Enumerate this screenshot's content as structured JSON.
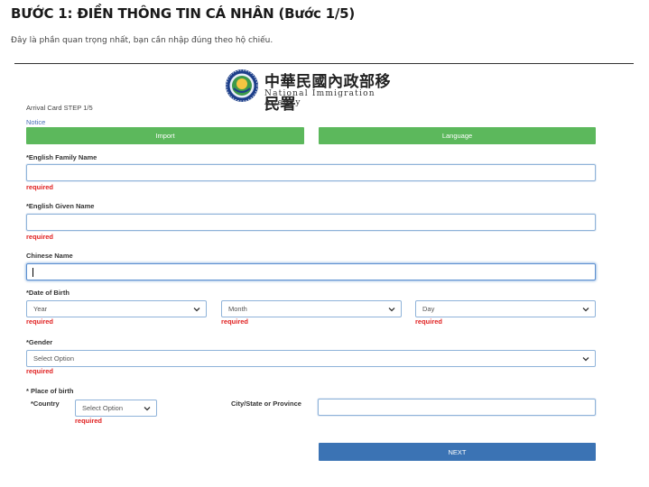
{
  "header": {
    "title": "BƯỚC 1: ĐIỀN THÔNG TIN CÁ NHÂN (Bước 1/5)",
    "subtitle": "Đây là phần quan trọng nhất, bạn cần nhập đúng theo hộ chiếu."
  },
  "agency": {
    "name_cn": "中華民國內政部移民署",
    "name_en": "National Immigration Agency"
  },
  "form": {
    "step_label": "Arrival Card STEP 1/5",
    "notice_link": "Notice",
    "import_label": "Import",
    "language_label": "Language",
    "family_name_label": "*English Family Name",
    "family_name_value": "",
    "given_name_label": "*English Given Name",
    "given_name_value": "",
    "chinese_name_label": "Chinese Name",
    "chinese_name_value": "",
    "dob_label": "*Date of Birth",
    "year_placeholder": "Year",
    "month_placeholder": "Month",
    "day_placeholder": "Day",
    "gender_label": "*Gender",
    "gender_placeholder": "Select Option",
    "place_of_birth_label": "* Place of birth",
    "country_label": "*Country",
    "country_placeholder": "Select Option",
    "city_label": "City/State or Province",
    "city_value": "",
    "required_text": "required",
    "next_label": "NEXT"
  },
  "colors": {
    "green_button": "#5cb85c",
    "blue_button": "#3b73b4",
    "required": "#e02020",
    "input_border": "#8fb3d9"
  }
}
